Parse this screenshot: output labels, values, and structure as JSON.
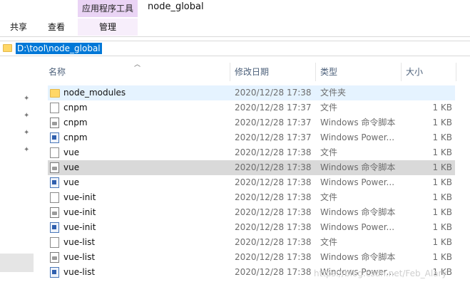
{
  "ribbon": {
    "context_group": "应用程序工具",
    "window_title": "node_global",
    "tabs": [
      {
        "label": "共享"
      },
      {
        "label": "查看"
      },
      {
        "label": "管理"
      }
    ]
  },
  "address": {
    "path": "D:\\tool\\node_global",
    "icon": "folder-icon"
  },
  "columns": {
    "name": "名称",
    "date": "修改日期",
    "type": "类型",
    "size": "大小"
  },
  "files": [
    {
      "name": "node_modules",
      "date": "2020/12/28 17:38",
      "type": "文件夹",
      "size": "",
      "icon": "folder-icon"
    },
    {
      "name": "cnpm",
      "date": "2020/12/28 17:37",
      "type": "文件",
      "size": "1 KB",
      "icon": "file-icon"
    },
    {
      "name": "cnpm",
      "date": "2020/12/28 17:37",
      "type": "Windows 命令脚本",
      "size": "1 KB",
      "icon": "cmd-script-icon"
    },
    {
      "name": "cnpm",
      "date": "2020/12/28 17:37",
      "type": "Windows Power...",
      "size": "1 KB",
      "icon": "powershell-icon"
    },
    {
      "name": "vue",
      "date": "2020/12/28 17:38",
      "type": "文件",
      "size": "1 KB",
      "icon": "file-icon"
    },
    {
      "name": "vue",
      "date": "2020/12/28 17:38",
      "type": "Windows 命令脚本",
      "size": "1 KB",
      "icon": "cmd-script-icon"
    },
    {
      "name": "vue",
      "date": "2020/12/28 17:38",
      "type": "Windows Power...",
      "size": "1 KB",
      "icon": "powershell-icon"
    },
    {
      "name": "vue-init",
      "date": "2020/12/28 17:38",
      "type": "文件",
      "size": "1 KB",
      "icon": "file-icon"
    },
    {
      "name": "vue-init",
      "date": "2020/12/28 17:38",
      "type": "Windows 命令脚本",
      "size": "1 KB",
      "icon": "cmd-script-icon"
    },
    {
      "name": "vue-init",
      "date": "2020/12/28 17:38",
      "type": "Windows Power...",
      "size": "1 KB",
      "icon": "powershell-icon"
    },
    {
      "name": "vue-list",
      "date": "2020/12/28 17:38",
      "type": "文件",
      "size": "1 KB",
      "icon": "file-icon"
    },
    {
      "name": "vue-list",
      "date": "2020/12/28 17:38",
      "type": "Windows 命令脚本",
      "size": "1 KB",
      "icon": "cmd-script-icon"
    },
    {
      "name": "vue-list",
      "date": "2020/12/28 17:38",
      "type": "Windows Power...",
      "size": "1 KB",
      "icon": "powershell-icon"
    }
  ],
  "watermark": "https://blog.csdn.net/Feb_Alary",
  "colors": {
    "context_tab": "#ead4f5",
    "selection": "#0078d7",
    "row_hover": "#e5f3ff",
    "row_selected": "#d9d9d9"
  }
}
